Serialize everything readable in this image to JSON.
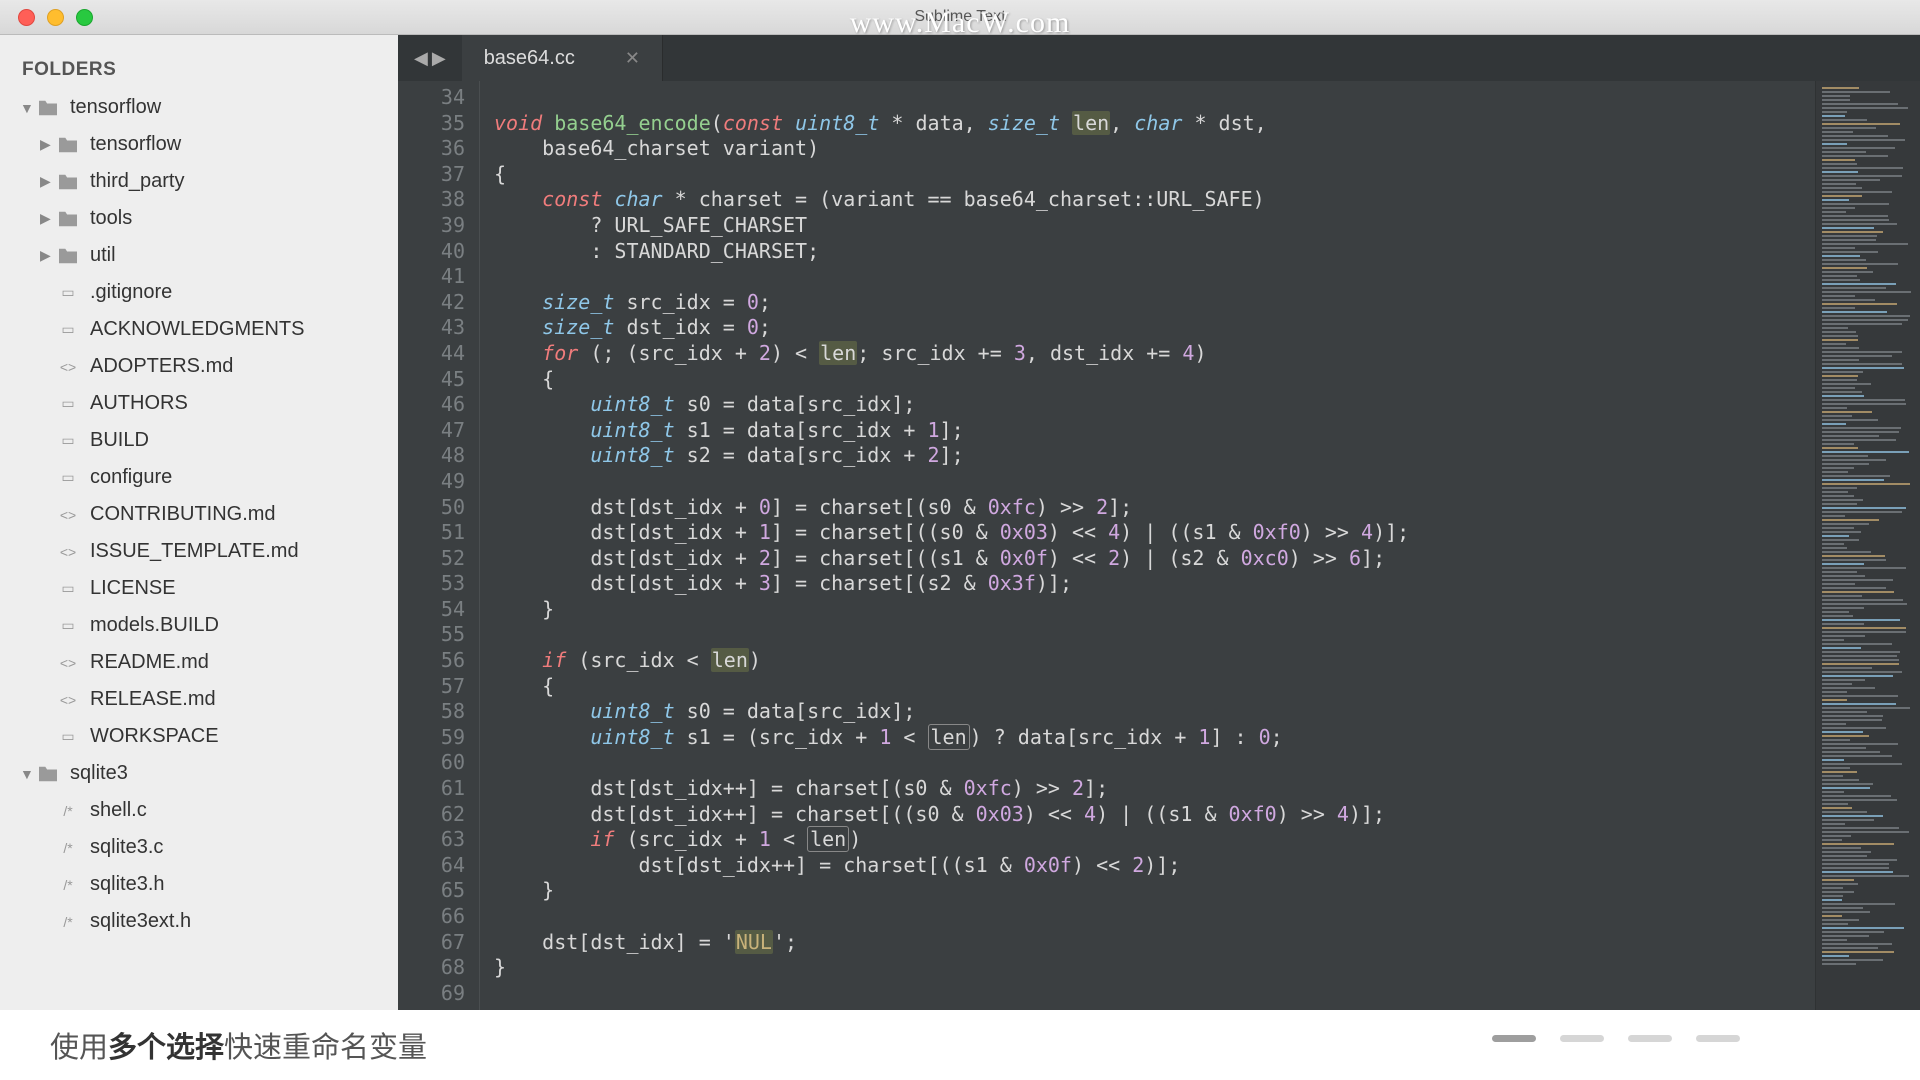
{
  "app_title": "Sublime Text",
  "watermark": "www.MacW.com",
  "tab": {
    "name": "base64.cc"
  },
  "sidebar": {
    "header": "FOLDERS",
    "items": [
      {
        "kind": "folder",
        "name": "tensorflow",
        "expanded": true,
        "depth": 0
      },
      {
        "kind": "folder",
        "name": "tensorflow",
        "expanded": false,
        "depth": 1
      },
      {
        "kind": "folder",
        "name": "third_party",
        "expanded": false,
        "depth": 1
      },
      {
        "kind": "folder",
        "name": "tools",
        "expanded": false,
        "depth": 1
      },
      {
        "kind": "folder",
        "name": "util",
        "expanded": false,
        "depth": 1
      },
      {
        "kind": "file",
        "name": ".gitignore",
        "icon": "txt",
        "depth": 1
      },
      {
        "kind": "file",
        "name": "ACKNOWLEDGMENTS",
        "icon": "txt",
        "depth": 1
      },
      {
        "kind": "file",
        "name": "ADOPTERS.md",
        "icon": "md",
        "depth": 1
      },
      {
        "kind": "file",
        "name": "AUTHORS",
        "icon": "txt",
        "depth": 1
      },
      {
        "kind": "file",
        "name": "BUILD",
        "icon": "txt",
        "depth": 1
      },
      {
        "kind": "file",
        "name": "configure",
        "icon": "txt",
        "depth": 1
      },
      {
        "kind": "file",
        "name": "CONTRIBUTING.md",
        "icon": "md",
        "depth": 1
      },
      {
        "kind": "file",
        "name": "ISSUE_TEMPLATE.md",
        "icon": "md",
        "depth": 1
      },
      {
        "kind": "file",
        "name": "LICENSE",
        "icon": "txt",
        "depth": 1
      },
      {
        "kind": "file",
        "name": "models.BUILD",
        "icon": "txt",
        "depth": 1
      },
      {
        "kind": "file",
        "name": "README.md",
        "icon": "md",
        "depth": 1
      },
      {
        "kind": "file",
        "name": "RELEASE.md",
        "icon": "md",
        "depth": 1
      },
      {
        "kind": "file",
        "name": "WORKSPACE",
        "icon": "txt",
        "depth": 1
      },
      {
        "kind": "folder",
        "name": "sqlite3",
        "expanded": true,
        "depth": 0
      },
      {
        "kind": "file",
        "name": "shell.c",
        "icon": "c",
        "depth": 1
      },
      {
        "kind": "file",
        "name": "sqlite3.c",
        "icon": "c",
        "depth": 1
      },
      {
        "kind": "file",
        "name": "sqlite3.h",
        "icon": "c",
        "depth": 1
      },
      {
        "kind": "file",
        "name": "sqlite3ext.h",
        "icon": "c",
        "depth": 1
      }
    ]
  },
  "code": {
    "first_line": 34,
    "lines": [
      "",
      "void base64_encode(const uint8_t * data, size_t len, char * dst,",
      "    base64_charset variant)",
      "{",
      "    const char * charset = (variant == base64_charset::URL_SAFE)",
      "        ? URL_SAFE_CHARSET",
      "        : STANDARD_CHARSET;",
      "",
      "    size_t src_idx = 0;",
      "    size_t dst_idx = 0;",
      "    for (; (src_idx + 2) < len; src_idx += 3, dst_idx += 4)",
      "    {",
      "        uint8_t s0 = data[src_idx];",
      "        uint8_t s1 = data[src_idx + 1];",
      "        uint8_t s2 = data[src_idx + 2];",
      "",
      "        dst[dst_idx + 0] = charset[(s0 & 0xfc) >> 2];",
      "        dst[dst_idx + 1] = charset[((s0 & 0x03) << 4) | ((s1 & 0xf0) >> 4)];",
      "        dst[dst_idx + 2] = charset[((s1 & 0x0f) << 2) | (s2 & 0xc0) >> 6];",
      "        dst[dst_idx + 3] = charset[(s2 & 0x3f)];",
      "    }",
      "",
      "    if (src_idx < len)",
      "    {",
      "        uint8_t s0 = data[src_idx];",
      "        uint8_t s1 = (src_idx + 1 < len) ? data[src_idx + 1] : 0;",
      "",
      "        dst[dst_idx++] = charset[(s0 & 0xfc) >> 2];",
      "        dst[dst_idx++] = charset[((s0 & 0x03) << 4) | ((s1 & 0xf0) >> 4)];",
      "        if (src_idx + 1 < len)",
      "            dst[dst_idx++] = charset[((s1 & 0x0f) << 2)];",
      "    }",
      "",
      "    dst[dst_idx] = 'NUL';",
      "}",
      ""
    ]
  },
  "caption": {
    "pre": "使用",
    "bold": "多个选择",
    "post": "快速重命名变量"
  }
}
